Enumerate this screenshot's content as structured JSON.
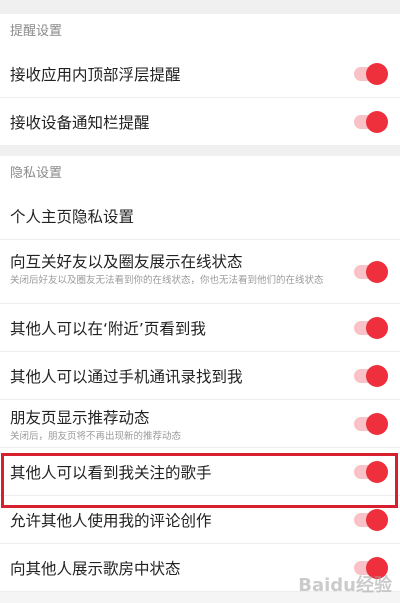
{
  "sections": [
    {
      "header": "提醒设置",
      "items": [
        {
          "title": "接收应用内顶部浮层提醒",
          "toggle": true
        },
        {
          "title": "接收设备通知栏提醒",
          "toggle": true
        }
      ]
    },
    {
      "header": "隐私设置",
      "items": [
        {
          "title": "个人主页隐私设置"
        },
        {
          "title": "向互关好友以及圈友展示在线状态",
          "desc": "关闭后好友以及圈友无法看到你的在线状态，你也无法看到他们的在线状态",
          "toggle": true
        },
        {
          "title": "其他人可以在‘附近’页看到我",
          "toggle": true
        },
        {
          "title": "其他人可以通过手机通讯录找到我",
          "toggle": true
        },
        {
          "title": "朋友页显示推荐动态",
          "desc": "关闭后，朋友页将不再出现新的推荐动态",
          "toggle": true
        },
        {
          "title": "其他人可以看到我关注的歌手",
          "toggle": true
        },
        {
          "title": "允许其他人使用我的评论创作",
          "toggle": true
        },
        {
          "title": "向其他人展示歌房中状态",
          "toggle": true
        }
      ]
    }
  ],
  "watermark": "Baidu经验",
  "colors": {
    "accent": "#ee2f3c",
    "highlight": "#d7202d"
  }
}
